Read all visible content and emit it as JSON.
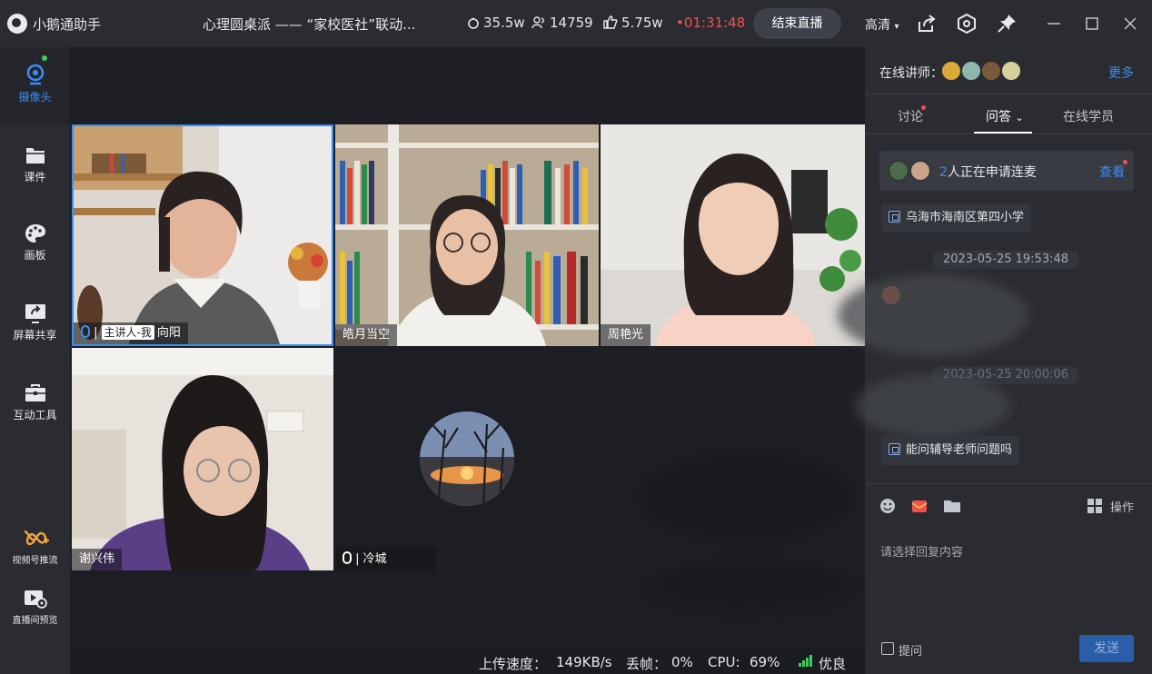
{
  "titlebar": {
    "app_name": "小鹅通助手",
    "live_title": "心理圆桌派 —— “家校医社”联动...",
    "heat": "35.5w",
    "viewers": "14759",
    "likes": "5.75w",
    "timer": "01:31:48",
    "end_button": "结束直播",
    "quality": "高清"
  },
  "sidebar": {
    "items": [
      {
        "label": "摄像头",
        "icon": "camera-icon"
      },
      {
        "label": "课件",
        "icon": "folder-icon"
      },
      {
        "label": "画板",
        "icon": "palette-icon"
      },
      {
        "label": "屏幕共享",
        "icon": "screen-share-icon"
      },
      {
        "label": "互动工具",
        "icon": "toolbox-icon"
      },
      {
        "label": "视频号推流",
        "icon": "channels-icon"
      },
      {
        "label": "直播间预览",
        "icon": "preview-icon"
      }
    ]
  },
  "tiles": [
    {
      "host_badge": "主讲人-我",
      "name": "向阳"
    },
    {
      "name": "皓月当空"
    },
    {
      "name": "周艳光"
    },
    {
      "name": "谢兴伟"
    },
    {
      "name": "冷城"
    }
  ],
  "statusbar": {
    "upload_label": "上传速度：",
    "upload_value": "149KB/s",
    "drop_label": "丢帧：",
    "drop_value": "0%",
    "cpu_label": "CPU:",
    "cpu_value": "69%",
    "network": "优良"
  },
  "panel": {
    "lecturers_label": "在线讲师：",
    "more": "更多",
    "tabs": [
      "讨论",
      "问答",
      "在线学员"
    ],
    "apply": {
      "count": "2",
      "text": "人正在申请连麦",
      "view": "查看"
    },
    "messages": [
      {
        "text": "乌海市海南区第四小学"
      },
      {
        "timestamp": "2023-05-25 19:53:48"
      },
      {
        "timestamp": "2023-05-25 20:00:06"
      },
      {
        "text": "能问辅导老师问题吗"
      }
    ],
    "tools_label": "操作",
    "reply_placeholder": "请选择回复内容",
    "ask_label": "提问",
    "send": "发送"
  },
  "colors": {
    "accent": "#3a8ef6",
    "live_red": "#f0524f",
    "bg": "#2a2c31"
  }
}
